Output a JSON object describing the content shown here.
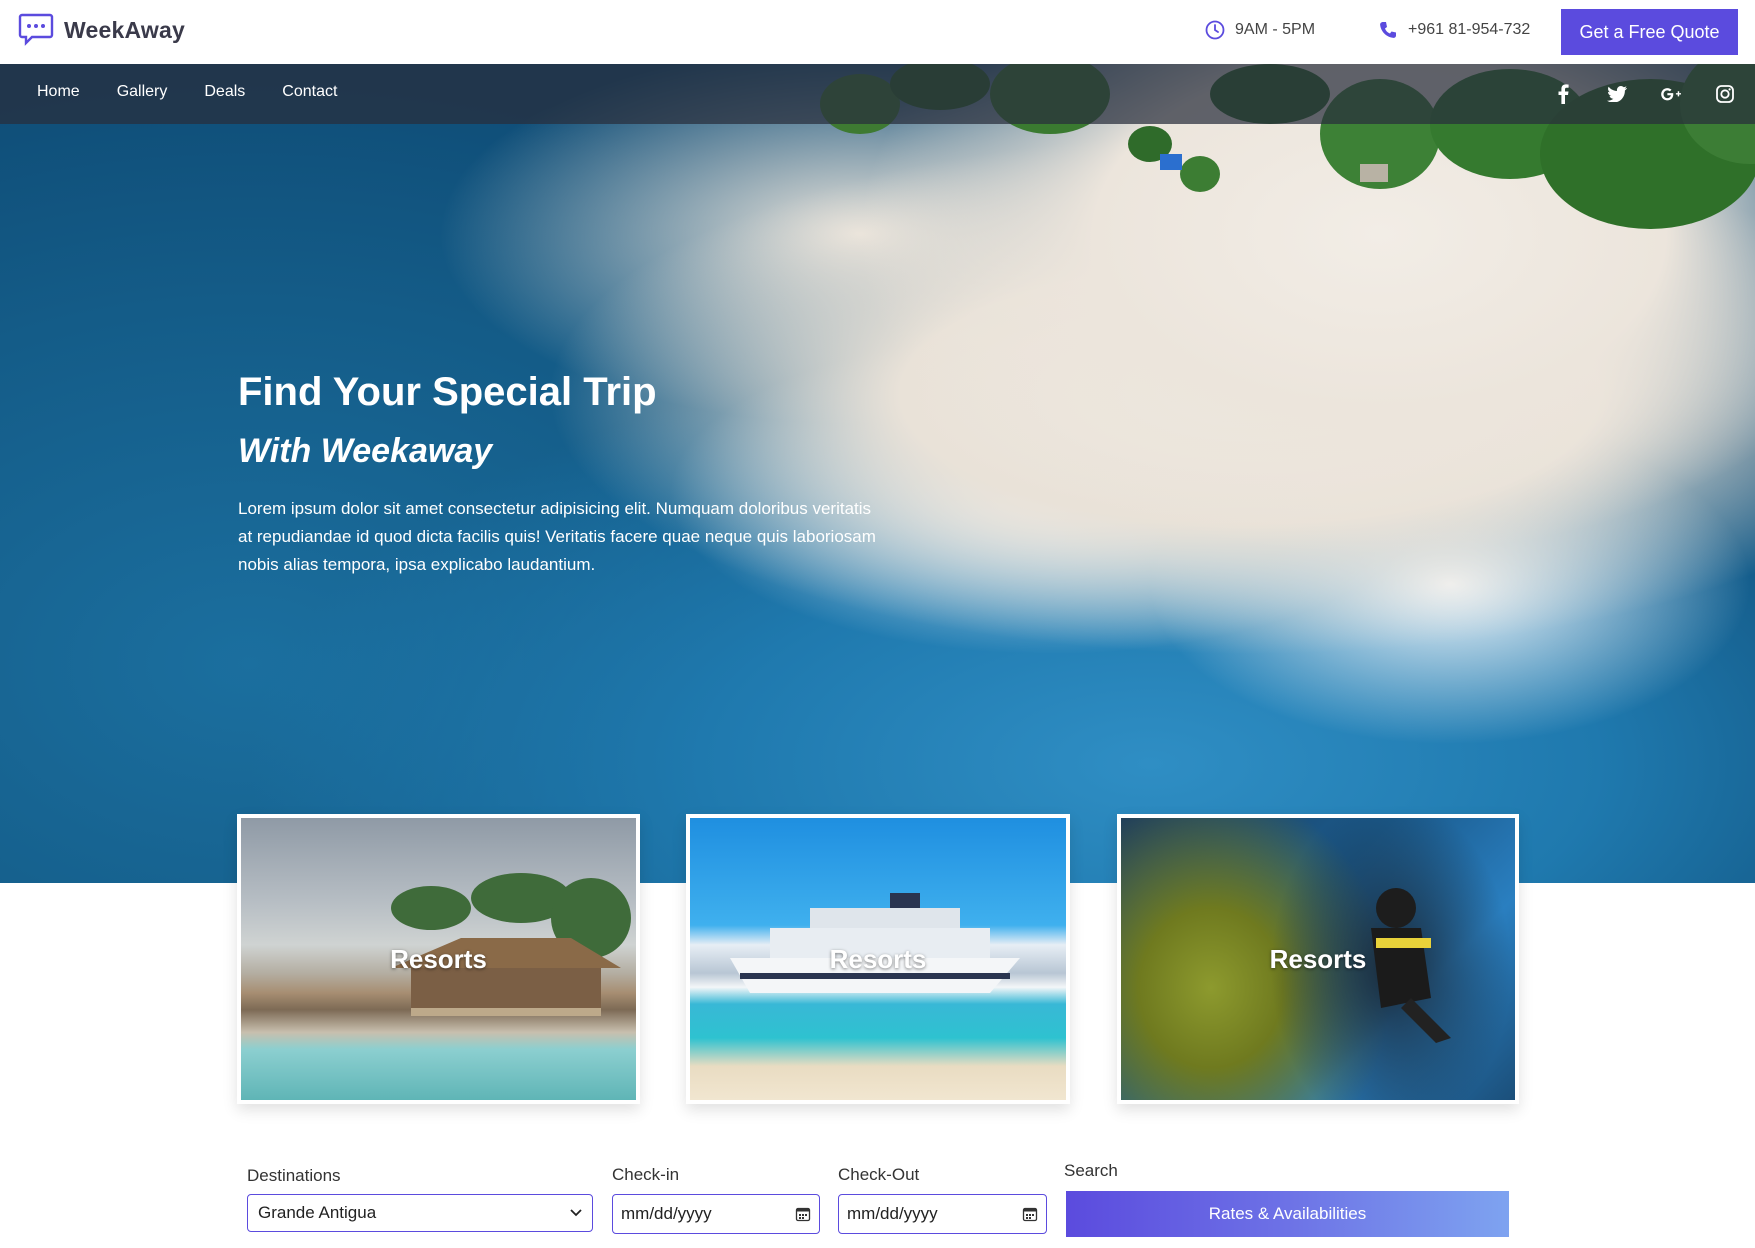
{
  "brand": {
    "name": "WeekAway",
    "icon": "chat-bubble-icon"
  },
  "contact": {
    "hours": "9AM - 5PM",
    "phone": "+961 81-954-732",
    "quote_button": "Get a Free Quote"
  },
  "nav": {
    "items": [
      "Home",
      "Gallery",
      "Deals",
      "Contact"
    ]
  },
  "socials": [
    "facebook-icon",
    "twitter-icon",
    "google-plus-icon",
    "instagram-icon"
  ],
  "hero": {
    "title": "Find Your Special Trip",
    "subtitle": "With Weekaway",
    "text": "Lorem ipsum dolor sit amet consectetur adipisicing elit. Numquam doloribus veritatis at repudiandae id quod dicta facilis quis! Veritatis facere quae neque quis laboriosam nobis alias tempora, ipsa explicabo laudantium."
  },
  "cards": [
    {
      "label": "Resorts"
    },
    {
      "label": "Resorts"
    },
    {
      "label": "Resorts"
    }
  ],
  "search": {
    "destinations_label": "Destinations",
    "destination_value": "Grande Antigua",
    "checkin_label": "Check-in",
    "checkin_placeholder": "mm/dd/yyyy",
    "checkout_label": "Check-Out",
    "checkout_placeholder": "mm/dd/yyyy",
    "search_label": "Search",
    "button": "Rates & Availabilities"
  },
  "colors": {
    "accent": "#5b4bde"
  }
}
